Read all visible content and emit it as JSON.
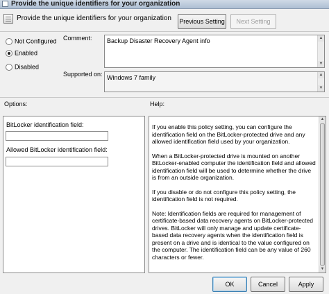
{
  "window": {
    "title": "Provide the unique identifiers for your organization"
  },
  "header": {
    "text": "Provide the unique identifiers for your organization",
    "previous_setting": "Previous Setting",
    "next_setting": "Next Setting"
  },
  "state": {
    "not_configured": "Not Configured",
    "enabled": "Enabled",
    "disabled": "Disabled",
    "selected": "Enabled"
  },
  "comment": {
    "label": "Comment:",
    "value": "Backup Disaster Recovery Agent info"
  },
  "supported": {
    "label": "Supported on:",
    "value": "Windows 7 family"
  },
  "options": {
    "label": "Options:",
    "fields": [
      {
        "label": "BitLocker identification field:",
        "value": ""
      },
      {
        "label": "Allowed BitLocker identification field:",
        "value": ""
      }
    ]
  },
  "help": {
    "label": "Help:",
    "paragraphs": [
      "If you enable this policy setting, you can configure the identification field on the BitLocker-protected drive and any allowed identification field used by your organization.",
      "When a BitLocker-protected drive is mounted on another BitLocker-enabled computer the identification field and allowed identification field will be used to determine whether the drive is from an outside organization.",
      "If you disable or do not configure this policy setting, the identification field is not required.",
      "Note: Identification fields are required for management of certificate-based data recovery agents on BitLocker-protected drives. BitLocker will only manage and update certificate-based data recovery agents when the identification field is present on a drive and is identical to the value configured on the computer. The identification field can be any value of 260 characters or fewer."
    ]
  },
  "buttons": {
    "ok": "OK",
    "cancel": "Cancel",
    "apply": "Apply"
  }
}
